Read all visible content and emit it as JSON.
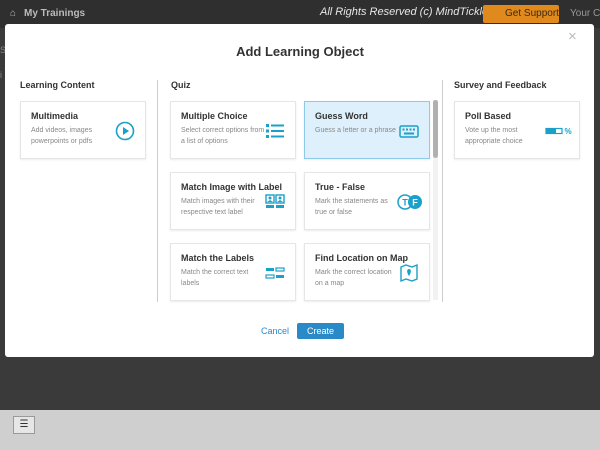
{
  "app": {
    "my_trainings": "My Trainings",
    "copyright": "All Rights Reserved (c) MindTickle 2013",
    "get_support": "Get Support",
    "your_courses": "Your Co",
    "side_left_1": "Se",
    "side_left_2": "i"
  },
  "modal": {
    "title": "Add Learning Object",
    "close": "×",
    "cancel": "Cancel",
    "create": "Create"
  },
  "sections": {
    "learning_content": "Learning Content",
    "quiz": "Quiz",
    "survey": "Survey and Feedback"
  },
  "cards": {
    "multimedia": {
      "title": "Multimedia",
      "desc": "Add videos, images powerpoints or pdfs",
      "icon": "play-icon"
    },
    "multiple_choice": {
      "title": "Multiple Choice",
      "desc": "Select correct options from a list of options",
      "icon": "list-icon"
    },
    "guess_word": {
      "title": "Guess Word",
      "desc": "Guess a letter or a phrase",
      "icon": "keyboard-icon"
    },
    "match_image": {
      "title": "Match Image with Label",
      "desc": "Match images with their respective text label",
      "icon": "image-label-icon"
    },
    "true_false": {
      "title": "True - False",
      "desc": "Mark the statements as true or false",
      "icon": "true-false-icon",
      "t": "T",
      "f": "F"
    },
    "match_labels": {
      "title": "Match the Labels",
      "desc": "Match the correct text labels",
      "icon": "labels-icon"
    },
    "find_location": {
      "title": "Find Location on Map",
      "desc": "Mark the correct location on a map",
      "icon": "map-icon"
    },
    "poll_based": {
      "title": "Poll Based",
      "desc": "Vote up the most appropriate choice",
      "icon": "poll-icon",
      "percent": "%"
    }
  },
  "colors": {
    "accent": "#1aa0c9",
    "button": "#2a8ac8",
    "selected_bg": "#def0fb",
    "support": "#e08a1e"
  }
}
